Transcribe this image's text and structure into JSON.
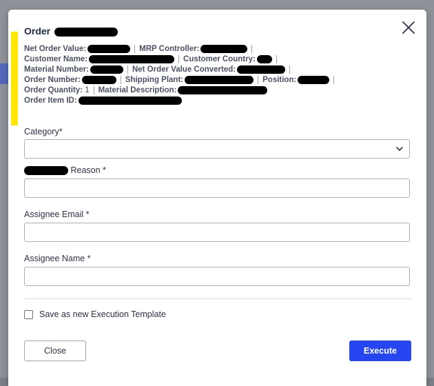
{
  "dialog": {
    "title": "Order",
    "close_icon": "close-icon"
  },
  "meta": {
    "net_order_value_label": "Net Order Value:",
    "mrp_controller_label": "MRP Controller:",
    "customer_name_label": "Customer Name:",
    "customer_country_label": "Customer Country:",
    "material_number_label": "Material Number:",
    "net_order_value_converted_label": "Net Order Value Converted:",
    "order_number_label": "Order Number:",
    "shipping_plant_label": "Shipping Plant:",
    "position_label": "Position:",
    "order_quantity_label": "Order Quantity:",
    "order_quantity_value": "1",
    "material_description_label": "Material Description:",
    "order_item_id_label": "Order Item ID:"
  },
  "form": {
    "category_label": "Category*",
    "category_value": "",
    "reason_label": "Reason *",
    "reason_value": "",
    "assignee_email_label": "Assignee Email *",
    "assignee_email_value": "",
    "assignee_name_label": "Assignee Name *",
    "assignee_name_value": "",
    "save_template_label": "Save as new Execution Template",
    "save_template_checked": false
  },
  "actions": {
    "close_label": "Close",
    "execute_label": "Execute",
    "execute_color": "#2546f0"
  },
  "colors": {
    "highlight": "#ffe600"
  }
}
